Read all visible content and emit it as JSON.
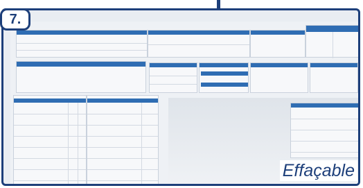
{
  "badge": {
    "number": "7."
  },
  "caption": {
    "text": "Effaçable"
  },
  "colors": {
    "frame": "#1d3f7a",
    "header": "#2f6db3",
    "board": "#eef1f5"
  }
}
